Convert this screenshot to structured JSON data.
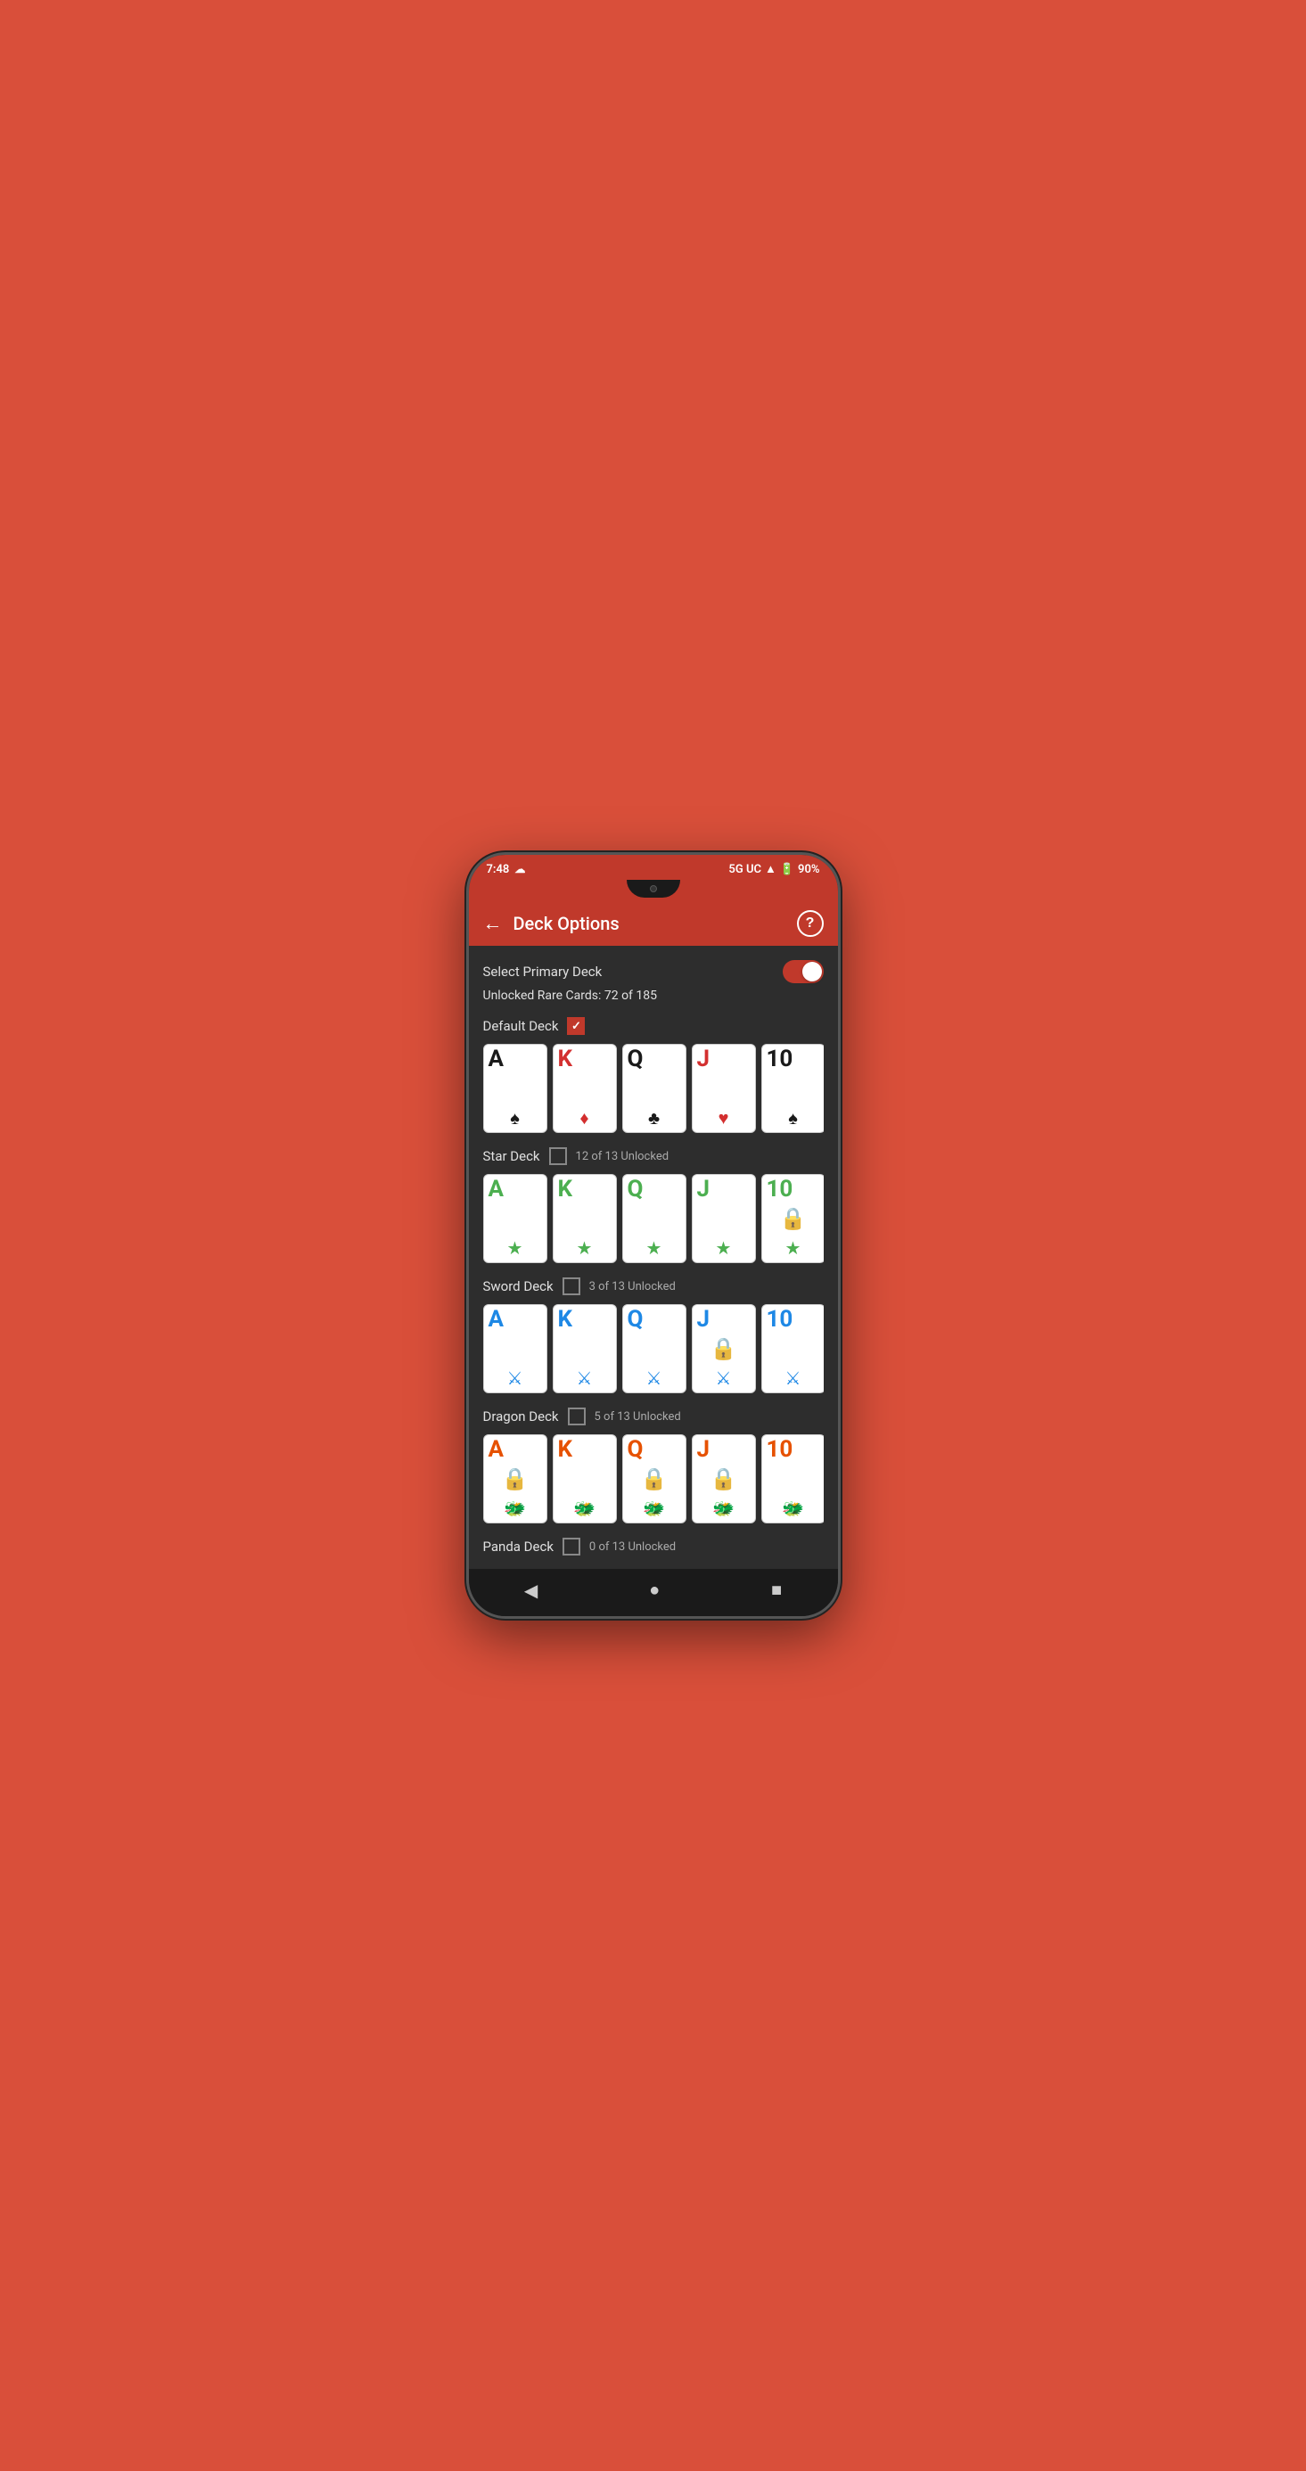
{
  "status_bar": {
    "time": "7:48",
    "signal": "5G UC",
    "battery": "90%"
  },
  "app_bar": {
    "title": "Deck Options",
    "back_label": "←",
    "help_label": "?"
  },
  "select_primary": {
    "label": "Select Primary Deck"
  },
  "rare_cards": {
    "text": "Unlocked Rare Cards: 72 of 185"
  },
  "decks": [
    {
      "name": "Default Deck",
      "checked": true,
      "unlock_text": "",
      "cards": [
        {
          "letter": "A",
          "suit": "♠",
          "color": "black",
          "locked": false
        },
        {
          "letter": "K",
          "suit": "♦",
          "color": "red",
          "locked": false
        },
        {
          "letter": "Q",
          "suit": "♣",
          "color": "black",
          "locked": false
        },
        {
          "letter": "J",
          "suit": "♥",
          "color": "red",
          "locked": false
        },
        {
          "letter": "10",
          "suit": "♠",
          "color": "black",
          "locked": false
        }
      ]
    },
    {
      "name": "Star Deck",
      "checked": false,
      "unlock_text": "12 of 13 Unlocked",
      "cards": [
        {
          "letter": "A",
          "suit": "★",
          "color": "green",
          "locked": false
        },
        {
          "letter": "K",
          "suit": "★",
          "color": "green",
          "locked": false
        },
        {
          "letter": "Q",
          "suit": "★",
          "color": "green",
          "locked": false
        },
        {
          "letter": "J",
          "suit": "★",
          "color": "green",
          "locked": false
        },
        {
          "letter": "10",
          "suit": "★",
          "color": "green",
          "locked": true
        }
      ]
    },
    {
      "name": "Sword Deck",
      "checked": false,
      "unlock_text": "3 of 13 Unlocked",
      "cards": [
        {
          "letter": "A",
          "suit": "🗡",
          "color": "blue",
          "locked": false
        },
        {
          "letter": "K",
          "suit": "🗡",
          "color": "blue",
          "locked": false
        },
        {
          "letter": "Q",
          "suit": "🗡",
          "color": "blue",
          "locked": false
        },
        {
          "letter": "J",
          "suit": "🗡",
          "color": "blue",
          "locked": true
        },
        {
          "letter": "10",
          "suit": "🗡",
          "color": "blue",
          "locked": false
        }
      ]
    },
    {
      "name": "Dragon Deck",
      "checked": false,
      "unlock_text": "5 of 13 Unlocked",
      "cards": [
        {
          "letter": "A",
          "suit": "🐉",
          "color": "orange",
          "locked": true
        },
        {
          "letter": "K",
          "suit": "🐉",
          "color": "orange",
          "locked": false
        },
        {
          "letter": "Q",
          "suit": "🐉",
          "color": "orange",
          "locked": true
        },
        {
          "letter": "J",
          "suit": "🐉",
          "color": "orange",
          "locked": true
        },
        {
          "letter": "10",
          "suit": "🐉",
          "color": "orange",
          "locked": false
        }
      ]
    },
    {
      "name": "Panda Deck",
      "checked": false,
      "unlock_text": "0 of 13 Unlocked",
      "cards": []
    }
  ],
  "bottom_nav": {
    "back": "◀",
    "home": "●",
    "recent": "■"
  }
}
